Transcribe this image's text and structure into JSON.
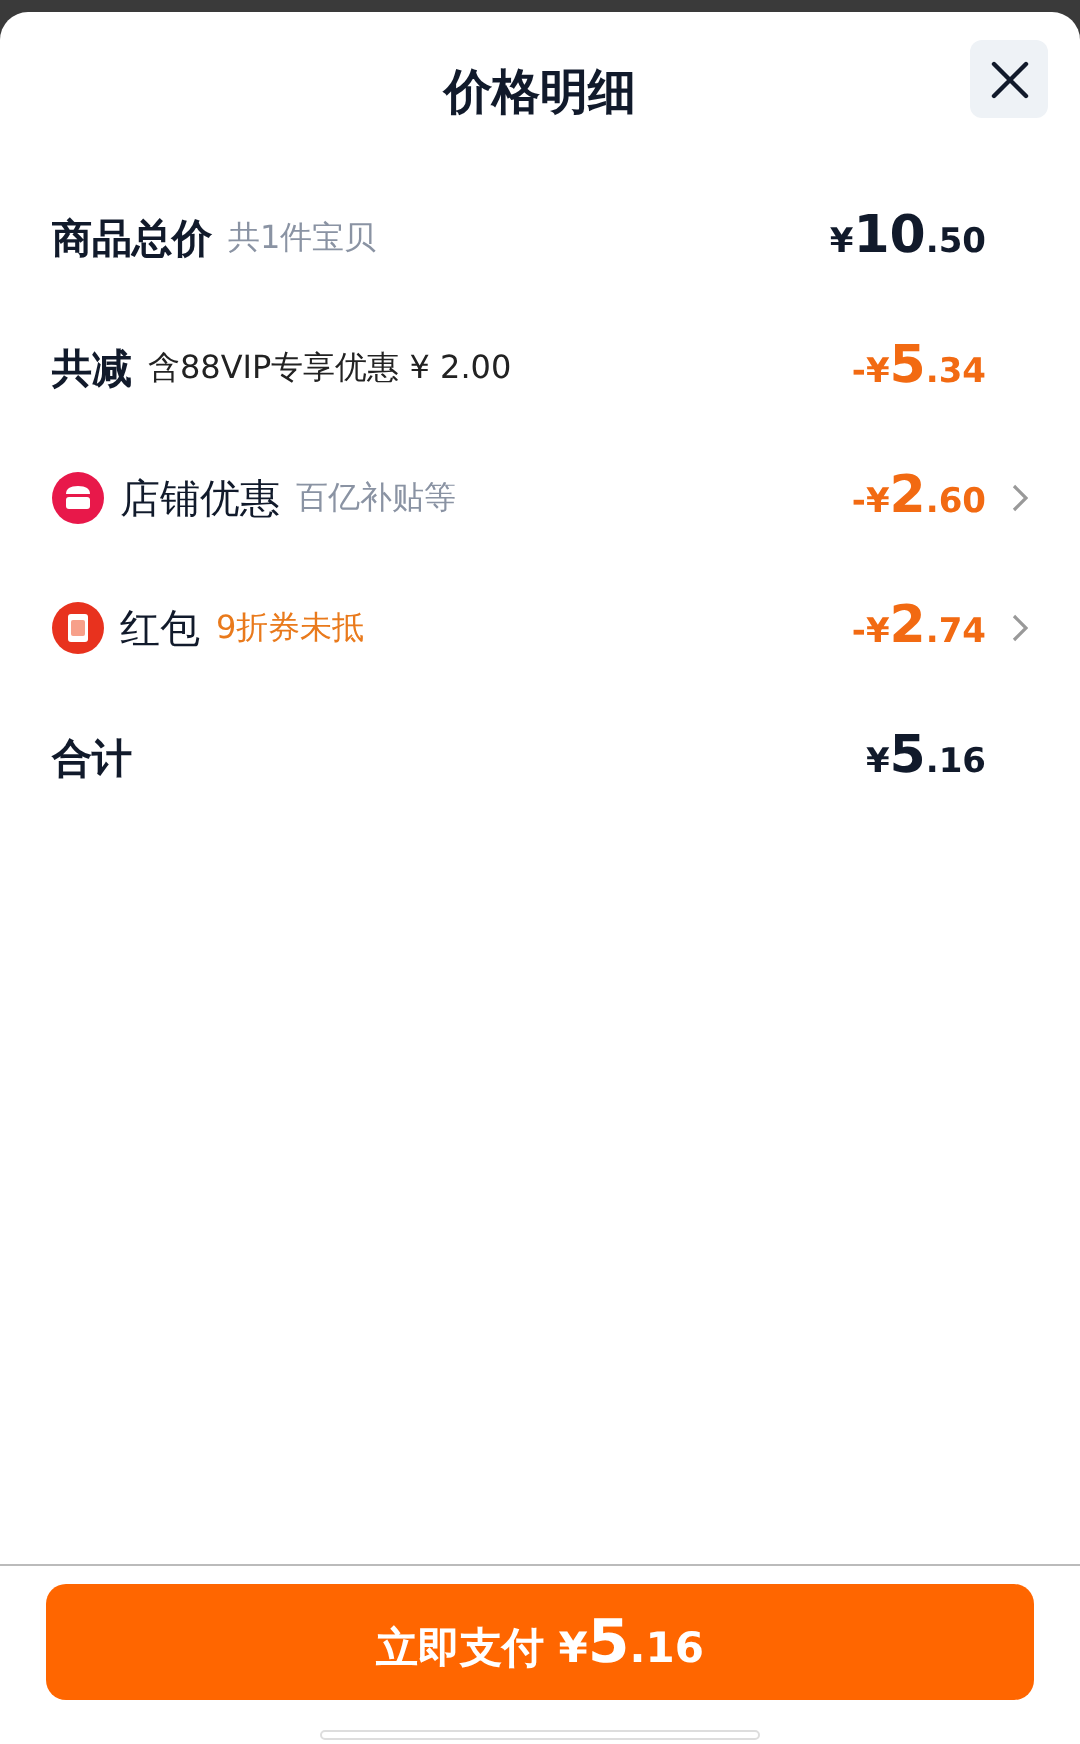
{
  "title": "价格明细",
  "rows": [
    {
      "kind": "summary",
      "label": "商品总价",
      "note": {
        "text": "共1件宝贝",
        "color": "#8a93a3"
      },
      "amount": {
        "currency": "¥",
        "integer": "10",
        "decimal": ".50",
        "color": "#111a2b"
      }
    },
    {
      "kind": "summary",
      "label": "共减",
      "note": {
        "text": "含88VIP专享优惠 ¥ 2.00",
        "color": "#222222"
      },
      "amount": {
        "sign": "-",
        "currency": "¥",
        "integer": "5",
        "decimal": ".34",
        "color": "#f26a12"
      }
    },
    {
      "kind": "shop",
      "label": "店铺优惠",
      "note": {
        "text": "百亿补贴等",
        "color": "#8a93a3"
      },
      "amount": {
        "sign": "-",
        "currency": "¥",
        "integer": "2",
        "decimal": ".60",
        "color": "#f26a12"
      }
    },
    {
      "kind": "packet",
      "label": "红包",
      "note": {
        "text": "9折券未抵",
        "color": "#e97a1c"
      },
      "amount": {
        "sign": "-",
        "currency": "¥",
        "integer": "2",
        "decimal": ".74",
        "color": "#f26a12"
      }
    },
    {
      "kind": "summary",
      "label": "合计",
      "amount": {
        "currency": "¥",
        "integer": "5",
        "decimal": ".16",
        "color": "#111a2b"
      }
    }
  ],
  "pay_button": {
    "label": "立即支付",
    "currency": "¥",
    "integer": "5",
    "decimal": ".16"
  }
}
